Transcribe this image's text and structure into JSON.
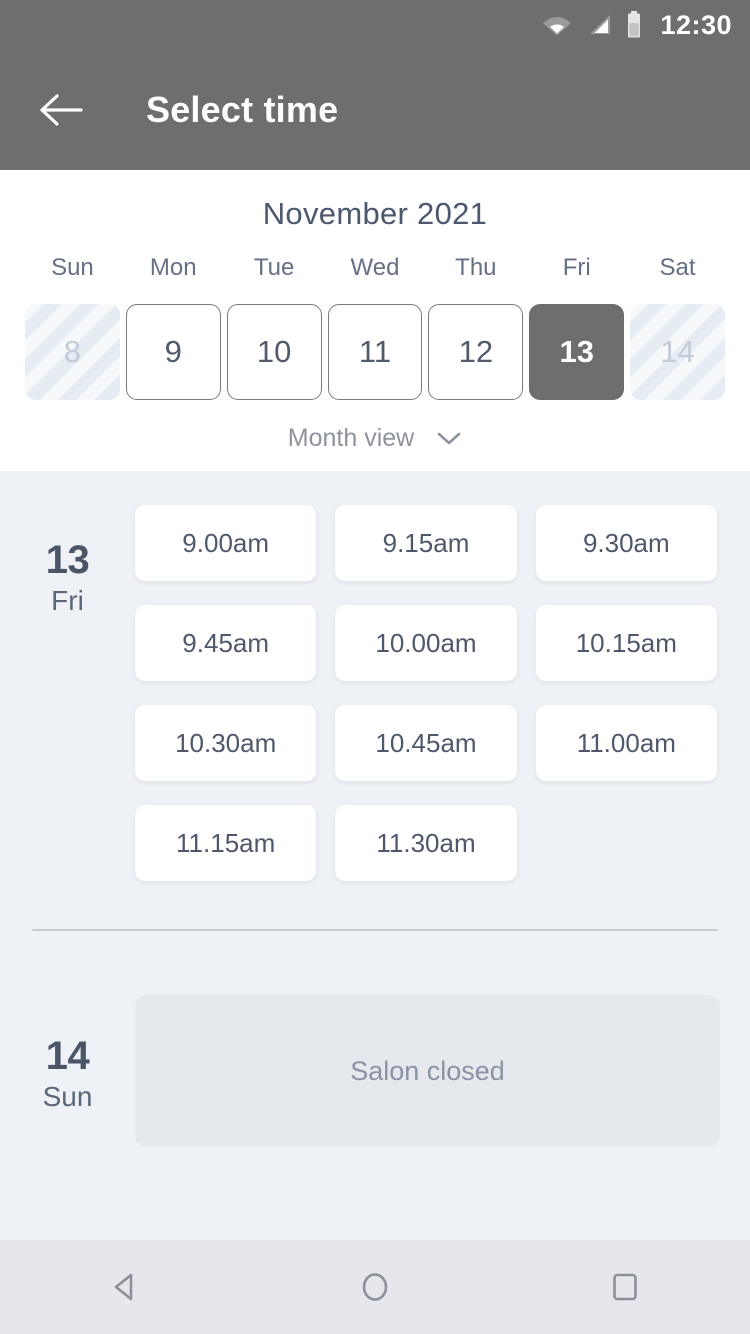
{
  "status_bar": {
    "time": "12:30",
    "icons": [
      "wifi-icon",
      "cellular-signal-icon",
      "battery-icon"
    ]
  },
  "app_bar": {
    "back_icon": "back-arrow-icon",
    "title": "Select time"
  },
  "calendar": {
    "month_title": "November 2021",
    "weekday_headers": [
      "Sun",
      "Mon",
      "Tue",
      "Wed",
      "Thu",
      "Fri",
      "Sat"
    ],
    "days": [
      {
        "number": "8",
        "state": "disabled"
      },
      {
        "number": "9",
        "state": "available"
      },
      {
        "number": "10",
        "state": "available"
      },
      {
        "number": "11",
        "state": "available"
      },
      {
        "number": "12",
        "state": "available"
      },
      {
        "number": "13",
        "state": "selected"
      },
      {
        "number": "14",
        "state": "disabled"
      }
    ],
    "view_toggle": {
      "label": "Month view",
      "icon": "chevron-down-icon"
    }
  },
  "schedule": {
    "groups": [
      {
        "day_number": "13",
        "day_name": "Fri",
        "slots": [
          "9.00am",
          "9.15am",
          "9.30am",
          "9.45am",
          "10.00am",
          "10.15am",
          "10.30am",
          "10.45am",
          "11.00am",
          "11.15am",
          "11.30am"
        ]
      },
      {
        "day_number": "14",
        "day_name": "Sun",
        "closed_message": "Salon closed"
      }
    ]
  },
  "nav_bar": {
    "buttons": [
      "back-triangle-icon",
      "home-circle-icon",
      "recents-square-icon"
    ]
  },
  "colors": {
    "app_bar": "#6e6e6e",
    "selected_day": "#6e6e6e",
    "page_background": "#eef1f6",
    "card_background": "#ffffff",
    "closed_panel": "#e5e8ed",
    "primary_text": "#4a5568",
    "muted_text": "#8a93a3",
    "nav_bar": "#e5e7ea"
  }
}
